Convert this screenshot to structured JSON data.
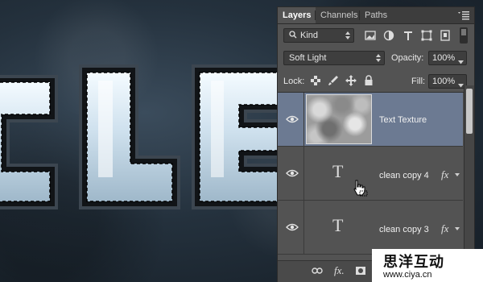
{
  "canvas": {
    "letters": [
      "C",
      "L",
      "E"
    ],
    "colors": {
      "background": "#1f2a35",
      "glass": "#dce9f2",
      "outline": "#1a1d20"
    }
  },
  "panel": {
    "tabs": [
      {
        "label": "Layers",
        "active": true
      },
      {
        "label": "Channels",
        "active": false
      },
      {
        "label": "Paths",
        "active": false
      }
    ],
    "filter": {
      "kind_label": "Kind",
      "icons": [
        "image-filter-icon",
        "adjustment-filter-icon",
        "type-filter-icon",
        "shape-filter-icon",
        "smart-object-filter-icon",
        "filter-toggle-switch"
      ]
    },
    "blend_mode": "Soft Light",
    "opacity_label": "Opacity:",
    "opacity_value": "100%",
    "lock_label": "Lock:",
    "lock_icons": [
      "lock-transparent-pixels-icon",
      "lock-image-pixels-icon",
      "lock-position-icon",
      "lock-all-icon"
    ],
    "fill_label": "Fill:",
    "fill_value": "100%",
    "layers": [
      {
        "name": "Text Texture",
        "kind": "pixel",
        "selected": true,
        "visible": true,
        "fx": false
      },
      {
        "name": "clean copy 4",
        "kind": "type",
        "selected": false,
        "visible": true,
        "fx": true,
        "type_glyph": "T",
        "fx_label": "fx"
      },
      {
        "name": "clean copy 3",
        "kind": "type",
        "selected": false,
        "visible": true,
        "fx": true,
        "type_glyph": "T",
        "fx_label": "fx"
      }
    ],
    "bottom_icons": [
      "link-layers-icon",
      "add-layer-style-icon",
      "add-mask-icon"
    ],
    "bottom_fx_label": "fx.",
    "colors": {
      "panel_bg": "#535353",
      "selected_row": "#6c7a92",
      "tab_bar": "#3d3d3d"
    }
  },
  "watermark": {
    "text": "思洋互动",
    "url": "www.ciya.cn"
  }
}
